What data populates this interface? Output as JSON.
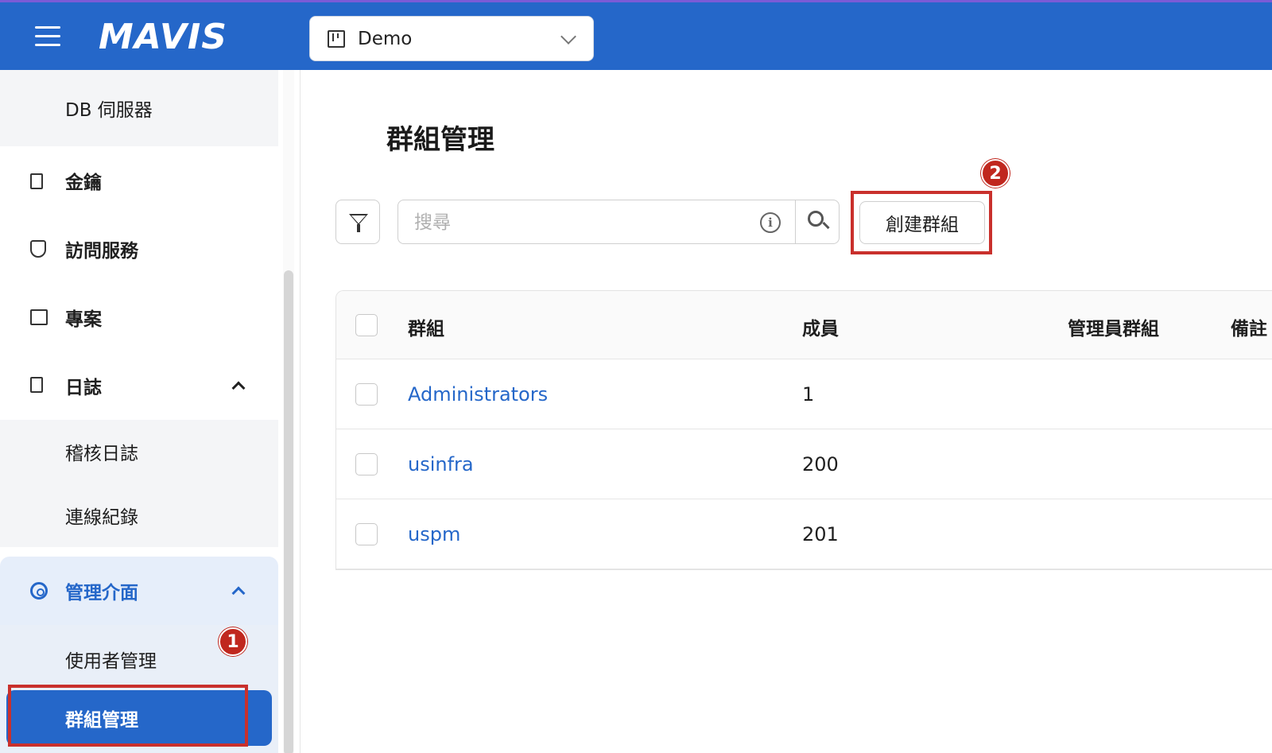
{
  "header": {
    "logo": "MAVIS",
    "project_selector": {
      "value": "Demo"
    }
  },
  "sidebar": {
    "items": [
      {
        "label": "DB 伺服器"
      },
      {
        "label": "金鑰",
        "icon": "key-icon"
      },
      {
        "label": "訪問服務",
        "icon": "shield-icon"
      },
      {
        "label": "專案",
        "icon": "project-icon"
      },
      {
        "label": "日誌",
        "icon": "log-icon"
      },
      {
        "label": "稽核日誌"
      },
      {
        "label": "連線紀錄"
      },
      {
        "label": "管理介面",
        "icon": "gear-icon"
      },
      {
        "label": "使用者管理"
      },
      {
        "label": "群組管理"
      }
    ]
  },
  "main": {
    "title": "群組管理",
    "search": {
      "placeholder": "搜尋",
      "value": ""
    },
    "create_button": "創建群組",
    "table": {
      "columns": [
        "群組",
        "成員",
        "管理員群組",
        "備註"
      ],
      "rows": [
        {
          "group": "Administrators",
          "members": "1"
        },
        {
          "group": "usinfra",
          "members": "200"
        },
        {
          "group": "uspm",
          "members": "201"
        }
      ]
    }
  },
  "annotations": {
    "badge_1": "1",
    "badge_2": "2"
  },
  "colors": {
    "brand": "#2567c9",
    "annotation_red": "#c0271e"
  }
}
